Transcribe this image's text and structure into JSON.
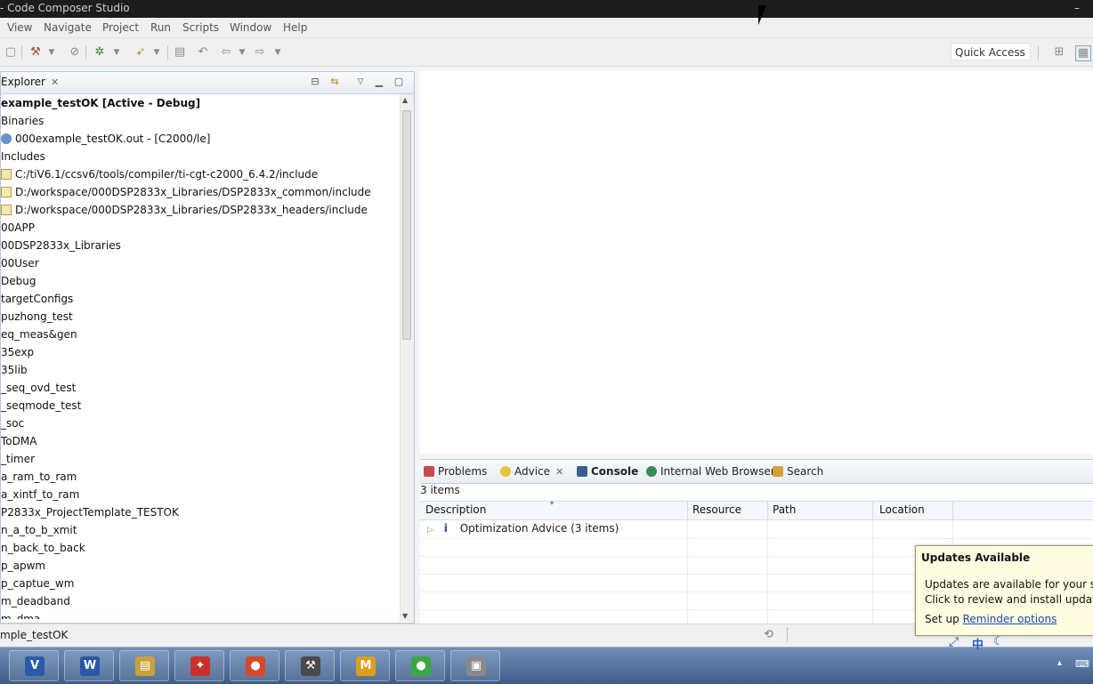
{
  "window": {
    "title": "- Code Composer Studio",
    "minimize_label": "–"
  },
  "menu": [
    "View",
    "Navigate",
    "Project",
    "Run",
    "Scripts",
    "Window",
    "Help"
  ],
  "toolbar": {
    "quick_access": "Quick Access"
  },
  "explorer": {
    "tab_label": "Explorer",
    "tree": [
      {
        "label": "example_testOK  [Active - Debug]",
        "bold": true,
        "icon": ""
      },
      {
        "label": "Binaries",
        "icon": ""
      },
      {
        "label": "000example_testOK.out - [C2000/le]",
        "icon": "binary-icon"
      },
      {
        "label": "Includes",
        "icon": ""
      },
      {
        "label": "C:/tiV6.1/ccsv6/tools/compiler/ti-cgt-c2000_6.4.2/include",
        "icon": "include-folder-icon"
      },
      {
        "label": "D:/workspace/000DSP2833x_Libraries/DSP2833x_common/include",
        "icon": "include-folder-icon"
      },
      {
        "label": "D:/workspace/000DSP2833x_Libraries/DSP2833x_headers/include",
        "icon": "include-folder-icon"
      },
      {
        "label": "00APP",
        "icon": ""
      },
      {
        "label": "00DSP2833x_Libraries",
        "icon": ""
      },
      {
        "label": "00User",
        "icon": ""
      },
      {
        "label": "Debug",
        "icon": ""
      },
      {
        "label": "targetConfigs",
        "icon": ""
      },
      {
        "label": "puzhong_test",
        "icon": ""
      },
      {
        "label": "eq_meas&gen",
        "icon": ""
      },
      {
        "label": "35exp",
        "icon": ""
      },
      {
        "label": "35lib",
        "icon": ""
      },
      {
        "label": "_seq_ovd_test",
        "icon": ""
      },
      {
        "label": "_seqmode_test",
        "icon": ""
      },
      {
        "label": "_soc",
        "icon": ""
      },
      {
        "label": "ToDMA",
        "icon": ""
      },
      {
        "label": "_timer",
        "icon": ""
      },
      {
        "label": "a_ram_to_ram",
        "icon": ""
      },
      {
        "label": "a_xintf_to_ram",
        "icon": ""
      },
      {
        "label": "P2833x_ProjectTemplate_TESTOK",
        "icon": ""
      },
      {
        "label": "n_a_to_b_xmit",
        "icon": ""
      },
      {
        "label": "n_back_to_back",
        "icon": ""
      },
      {
        "label": "p_apwm",
        "icon": ""
      },
      {
        "label": "p_captue_wm",
        "icon": ""
      },
      {
        "label": "m_deadband",
        "icon": ""
      },
      {
        "label": "m_dma",
        "icon": ""
      }
    ]
  },
  "bottom_panel": {
    "tabs": [
      {
        "label": "Problems",
        "active": false
      },
      {
        "label": "Advice",
        "active": false
      },
      {
        "label": "Console",
        "active": true
      },
      {
        "label": "Internal Web Browser",
        "active": false
      },
      {
        "label": "Search",
        "active": false
      }
    ],
    "item_count": "3 items",
    "columns": [
      "Description",
      "Resource",
      "Path",
      "Location"
    ],
    "rows": [
      {
        "description": "Optimization Advice (3 items)"
      }
    ]
  },
  "status_bar": {
    "text": "mple_testOK"
  },
  "updates_popup": {
    "title": "Updates Available",
    "line1": "Updates are available for your s",
    "line2": "Click to review and install update",
    "line3_prefix": "Set up",
    "link": "Reminder options"
  },
  "taskbar": {
    "apps": [
      {
        "name": "visio-app-icon",
        "glyph": "V",
        "color": "#2a5ba8"
      },
      {
        "name": "word-app-icon",
        "glyph": "W",
        "color": "#2b57a6"
      },
      {
        "name": "file-explorer-icon",
        "glyph": "▤",
        "color": "#c9a33a"
      },
      {
        "name": "pdf-reader-icon",
        "glyph": "✦",
        "color": "#c8312c"
      },
      {
        "name": "browser-icon",
        "glyph": "●",
        "color": "#d44a2a"
      },
      {
        "name": "ccs-app-icon",
        "glyph": "⚒",
        "color": "#4a4a4a"
      },
      {
        "name": "mfc-app-icon",
        "glyph": "M",
        "color": "#d9a020"
      },
      {
        "name": "wechat-icon",
        "glyph": "●",
        "color": "#3aa845"
      },
      {
        "name": "package-app-icon",
        "glyph": "▣",
        "color": "#8a8a8a"
      }
    ],
    "tray_text": "中"
  }
}
